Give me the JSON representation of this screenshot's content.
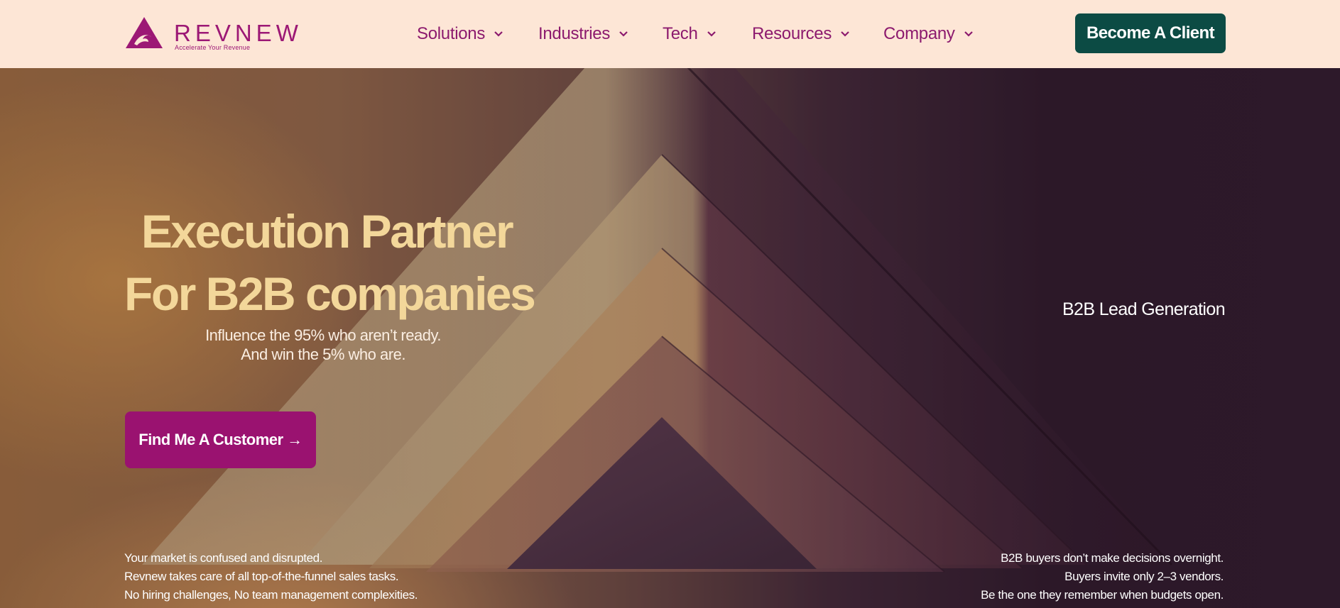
{
  "brand": {
    "name": "REVNEW",
    "tagline": "Accelerate Your Revenue",
    "colors": {
      "primary": "#9c1875",
      "header_bg": "#fde6d6",
      "cta_dark": "#0c4b44",
      "headline": "#f3d79a"
    }
  },
  "nav": {
    "items": [
      {
        "label": "Solutions",
        "icon": "chevron-down-icon"
      },
      {
        "label": "Industries",
        "icon": "chevron-down-icon"
      },
      {
        "label": "Tech",
        "icon": "chevron-down-icon"
      },
      {
        "label": "Resources",
        "icon": "chevron-down-icon"
      },
      {
        "label": "Company",
        "icon": "chevron-down-icon"
      }
    ],
    "cta_label": "Become A Client"
  },
  "hero": {
    "headline_line1": "Execution Partner",
    "headline_line2": "For B2B companies",
    "sub_line1": "Influence the 95% who aren’t ready.",
    "sub_line2": "And win the 5% who are.",
    "cta_label": "Find Me A Customer →",
    "service_label": "B2B Lead Generation",
    "left_points": [
      "Your market is confused and disrupted.",
      "Revnew takes care of all top-of-the-funnel sales tasks.",
      "No hiring challenges, No team management complexities."
    ],
    "right_points": [
      "B2B buyers don’t make decisions overnight.",
      "Buyers invite only 2–3 vendors.",
      "Be the one they remember when budgets open."
    ]
  }
}
